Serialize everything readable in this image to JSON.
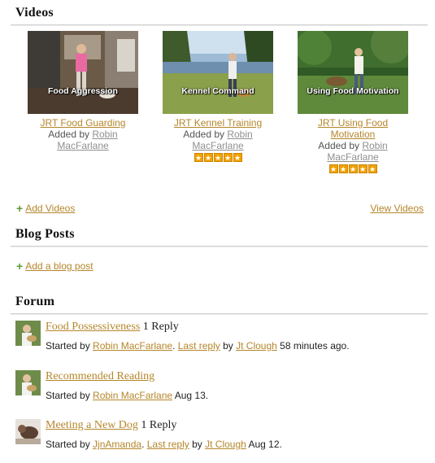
{
  "videos_section": {
    "title": "Videos",
    "items": [
      {
        "caption": "Food Aggression",
        "title": "JRT Food Guarding",
        "added_by_prefix": "Added by ",
        "author": "Robin MacFarlane",
        "rating": 0
      },
      {
        "caption": "Kennel Command",
        "title": "JRT Kennel Training",
        "added_by_prefix": "Added by ",
        "author": "Robin MacFarlane",
        "rating": 5
      },
      {
        "caption": "Using Food Motivation",
        "title": "JRT Using Food Motivation",
        "added_by_prefix": "Added by ",
        "author": "Robin MacFarlane",
        "rating": 5
      }
    ],
    "add_label": "Add Videos",
    "view_label": "View Videos"
  },
  "blog_section": {
    "title": "Blog Posts",
    "add_label": "Add a blog post"
  },
  "forum_section": {
    "title": "Forum",
    "items": [
      {
        "title": "Food Possessiveness",
        "replies": "1 Reply",
        "started_prefix": "Started by ",
        "author": "Robin MacFarlane",
        "sep": ". ",
        "last_reply_label": "Last reply",
        "by_text": " by ",
        "last_author": "Jt Clough",
        "time": " 58 minutes ago."
      },
      {
        "title": "Recommended Reading",
        "replies": "",
        "started_prefix": "Started by ",
        "author": "Robin MacFarlane",
        "sep": "",
        "last_reply_label": "",
        "by_text": "",
        "last_author": "",
        "time": " Aug 13."
      },
      {
        "title": "Meeting a New Dog",
        "replies": "1 Reply",
        "started_prefix": "Started by ",
        "author": "JjnAmanda",
        "sep": ". ",
        "last_reply_label": "Last reply",
        "by_text": " by ",
        "last_author": "Jt Clough",
        "time": " Aug 12."
      }
    ]
  },
  "colors": {
    "link": "#b5862b",
    "plus": "#5d9d37",
    "star": "#f2a100"
  },
  "icons": {
    "add": "plus-icon",
    "rating": "star-icon"
  }
}
